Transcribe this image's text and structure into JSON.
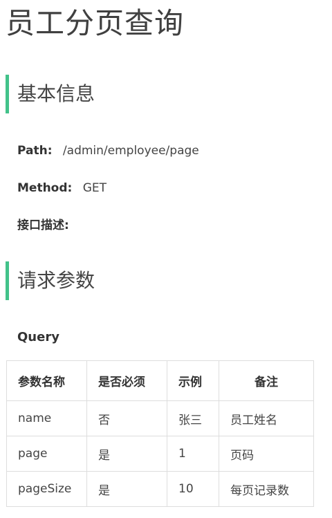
{
  "page": {
    "title": "员工分页查询"
  },
  "basic_info": {
    "heading": "基本信息",
    "path_label": "Path:",
    "path_value": "/admin/employee/page",
    "method_label": "Method:",
    "method_value": "GET",
    "desc_label": "接口描述:",
    "desc_value": ""
  },
  "request_params": {
    "heading": "请求参数",
    "query_label": "Query",
    "columns": [
      "参数名称",
      "是否必须",
      "示例",
      "备注"
    ],
    "rows": [
      [
        "name",
        "否",
        "张三",
        "员工姓名"
      ],
      [
        "page",
        "是",
        "1",
        "页码"
      ],
      [
        "pageSize",
        "是",
        "10",
        "每页记录数"
      ]
    ]
  },
  "colors": {
    "accent_bar": "#42c28a",
    "table_border": "#dddddd"
  }
}
